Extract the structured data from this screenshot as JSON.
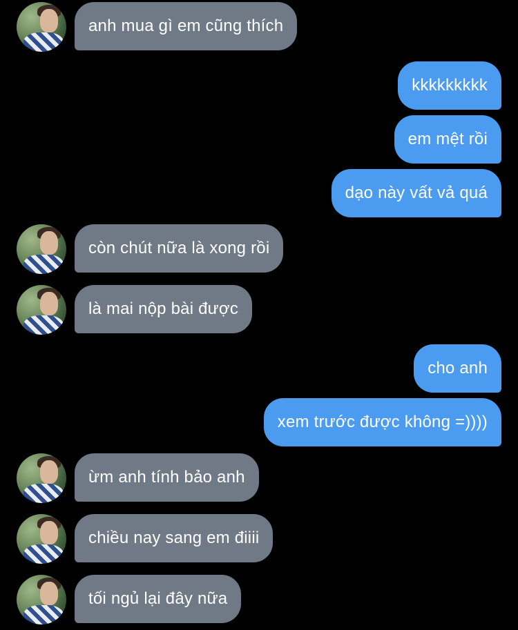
{
  "conversation": {
    "messages": [
      {
        "direction": "in",
        "text": "anh mua gì em cũng thích",
        "avatar_icon": "contact-avatar-icon"
      },
      {
        "direction": "out",
        "text": "kkkkkkkkk"
      },
      {
        "direction": "out",
        "text": "em mệt rồi"
      },
      {
        "direction": "out",
        "text": "dạo này vất vả quá"
      },
      {
        "direction": "in",
        "text": "còn chút nữa là xong rồi",
        "avatar_icon": "contact-avatar-icon"
      },
      {
        "direction": "in",
        "text": "là mai nộp bài được",
        "avatar_icon": "contact-avatar-icon"
      },
      {
        "direction": "out",
        "text": "cho anh"
      },
      {
        "direction": "out",
        "text": "xem trước được không =))))"
      },
      {
        "direction": "in",
        "text": "ừm anh tính bảo anh",
        "avatar_icon": "contact-avatar-icon"
      },
      {
        "direction": "in",
        "text": "chiều nay sang em điiii",
        "avatar_icon": "contact-avatar-icon"
      },
      {
        "direction": "in",
        "text": "tối ngủ lại đây nữa",
        "avatar_icon": "contact-avatar-icon"
      }
    ]
  },
  "colors": {
    "background": "#000000",
    "incoming_bubble": "#6f7a86",
    "outgoing_bubble": "#4b9cf0",
    "text": "#ffffff"
  }
}
